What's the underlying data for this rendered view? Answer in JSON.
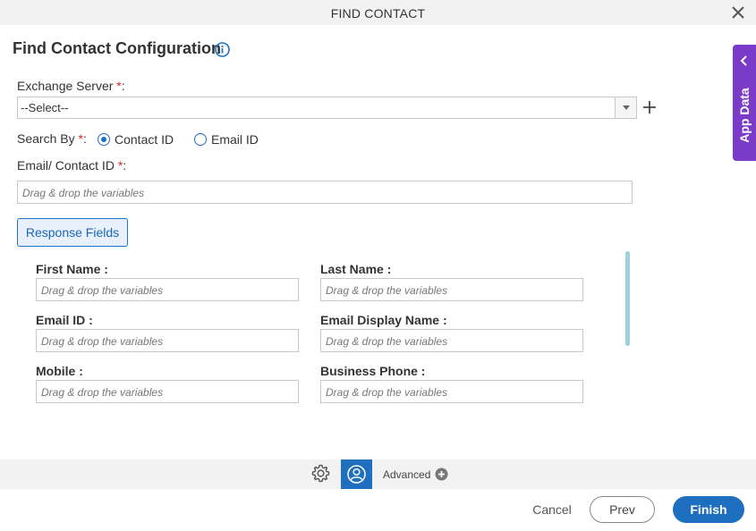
{
  "window": {
    "title": "FIND CONTACT"
  },
  "heading": "Find Contact Configuration",
  "exchange_server": {
    "label": "Exchange Server",
    "required": "*",
    "colon": ":",
    "value": "--Select--"
  },
  "search_by": {
    "label": "Search By",
    "required": "*",
    "colon": ":",
    "options": [
      {
        "label": "Contact ID",
        "checked": true
      },
      {
        "label": "Email ID",
        "checked": false
      }
    ]
  },
  "email_contact_id": {
    "label": "Email/ Contact ID",
    "required": "*",
    "colon": ":",
    "placeholder": "Drag & drop the variables"
  },
  "response_fields_button": "Response Fields",
  "response_fields": [
    {
      "label": "First Name :",
      "placeholder": "Drag & drop the variables"
    },
    {
      "label": "Last Name :",
      "placeholder": "Drag & drop the variables"
    },
    {
      "label": "Email ID :",
      "placeholder": "Drag & drop the variables"
    },
    {
      "label": "Email Display Name :",
      "placeholder": "Drag & drop the variables"
    },
    {
      "label": "Mobile :",
      "placeholder": "Drag & drop the variables"
    },
    {
      "label": "Business Phone :",
      "placeholder": "Drag & drop the variables"
    }
  ],
  "app_data_tab": "App Data",
  "toolbar": {
    "advanced_label": "Advanced"
  },
  "footer": {
    "cancel": "Cancel",
    "prev": "Prev",
    "finish": "Finish"
  },
  "colors": {
    "accent": "#1f6fc0",
    "app_data": "#7a3cc8",
    "required": "#d9262b"
  },
  "icons": [
    "close-icon",
    "info-icon",
    "plus-icon",
    "chevron-left-icon",
    "gear-icon",
    "user-icon",
    "plus-circle-icon"
  ]
}
